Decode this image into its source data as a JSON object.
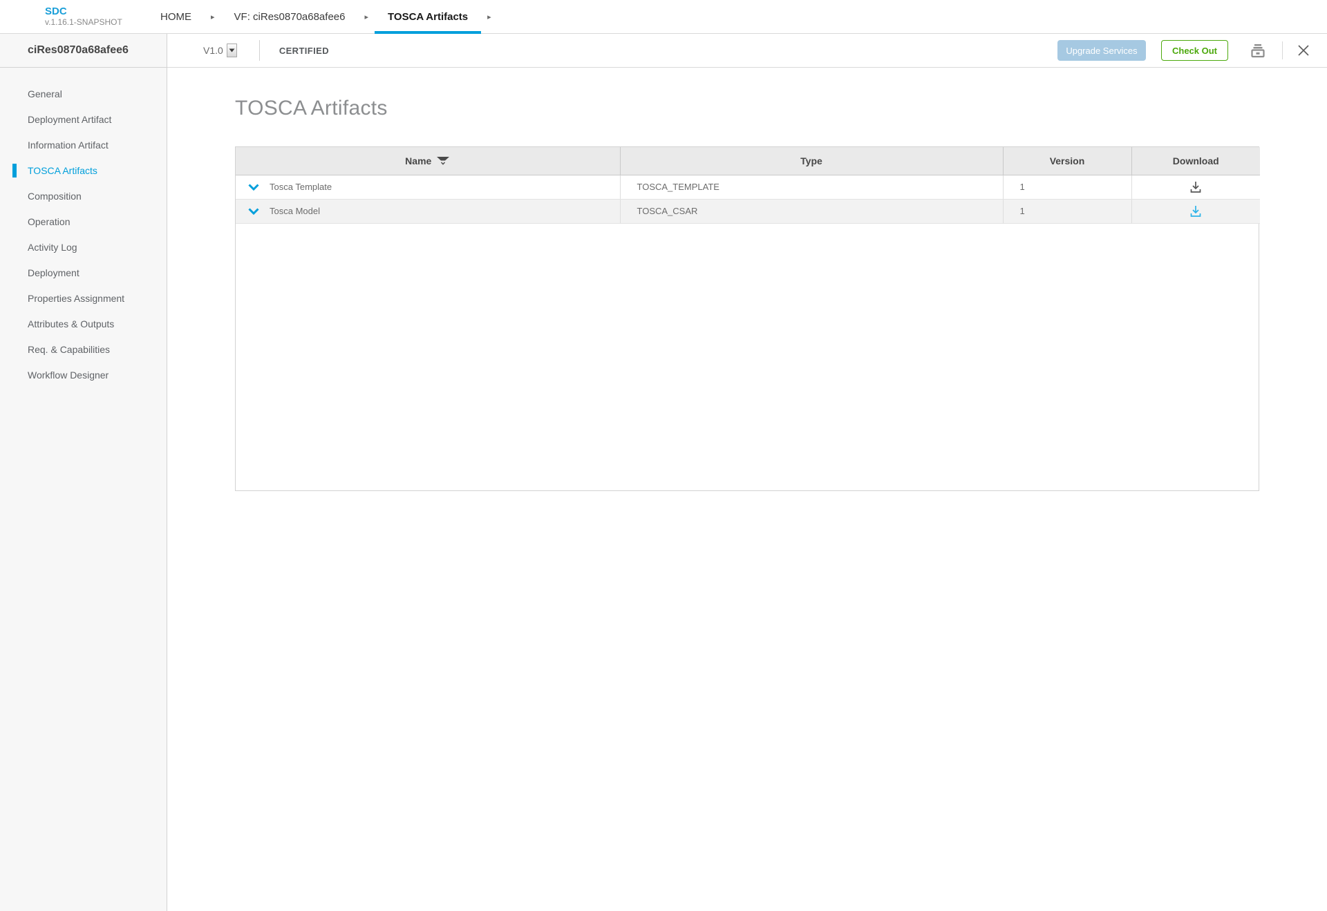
{
  "app": {
    "logo_title": "SDC",
    "logo_version": "v.1.16.1-SNAPSHOT",
    "breadcrumbs": [
      {
        "label": "HOME"
      },
      {
        "label": "VF: ciRes0870a68afee6"
      },
      {
        "label": "TOSCA Artifacts"
      }
    ]
  },
  "header": {
    "component_name": "ciRes0870a68afee6",
    "version_label": "V1.0",
    "status_label": "CERTIFIED",
    "upgrade_label": "Upgrade Services",
    "checkout_label": "Check Out"
  },
  "sidebar": {
    "items": [
      {
        "label": "General"
      },
      {
        "label": "Deployment Artifact"
      },
      {
        "label": "Information Artifact"
      },
      {
        "label": "TOSCA Artifacts"
      },
      {
        "label": "Composition"
      },
      {
        "label": "Operation"
      },
      {
        "label": "Activity Log"
      },
      {
        "label": "Deployment"
      },
      {
        "label": "Properties Assignment"
      },
      {
        "label": "Attributes & Outputs"
      },
      {
        "label": "Req. & Capabilities"
      },
      {
        "label": "Workflow Designer"
      }
    ]
  },
  "main": {
    "title": "TOSCA Artifacts",
    "table": {
      "columns": [
        "Name",
        "Type",
        "Version",
        "Download"
      ],
      "rows": [
        {
          "name": "Tosca Template",
          "type": "TOSCA_TEMPLATE",
          "version": "1"
        },
        {
          "name": "Tosca Model",
          "type": "TOSCA_CSAR",
          "version": "1"
        }
      ]
    }
  },
  "colors": {
    "accent_blue": "#009fdb",
    "download_default_gray": "#555555",
    "download_highlight_blue": "#2bb3e8",
    "checkout_green": "#4ca90c",
    "upgrade_disabled_blue": "#a6c9e2"
  }
}
